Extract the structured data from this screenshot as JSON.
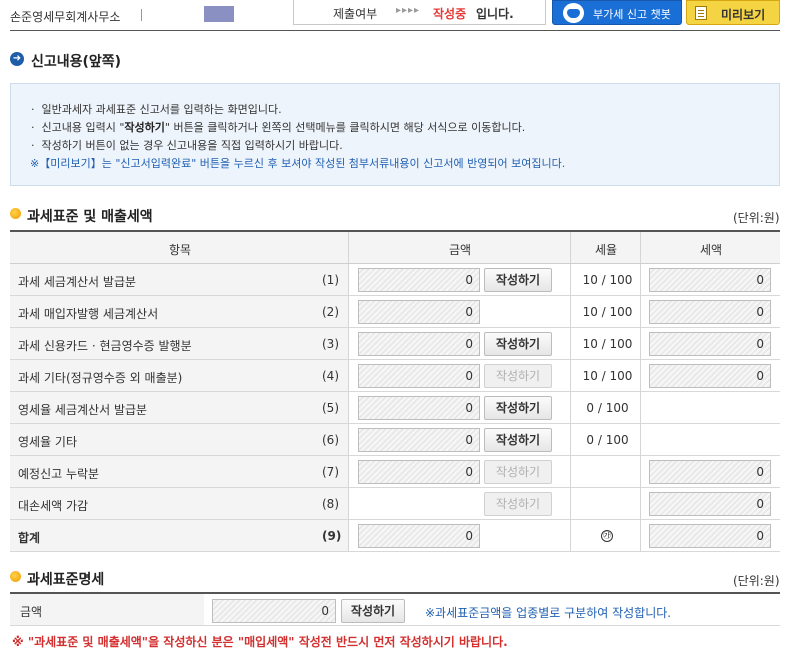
{
  "header": {
    "office_name": "손준영세무회계사무소",
    "status_label": "제출여부",
    "status_arrows": "▸▸▸▸",
    "status_value": "작성중",
    "status_suffix": "입니다.",
    "chatbot_button": "부가세 신고 챗봇",
    "preview_button": "미리보기"
  },
  "section1": {
    "title": "신고내용(앞쪽)",
    "info": {
      "line1": "일반과세자 과세표준 신고서를 입력하는 화면입니다.",
      "line2_pre": "신고내용 입력시 \"",
      "line2_bold": "작성하기",
      "line2_post": "\" 버튼을 클릭하거나 왼쪽의 선택메뉴를 클릭하시면 해당 서식으로 이동합니다.",
      "line3": "작성하기 버튼이 없는 경우 신고내용을 직접 입력하시기 바랍니다.",
      "note": "※【미리보기】는 \"신고서입력완료\" 버튼을 누르신 후 보셔야 작성된 첨부서류내용이 신고서에 반영되어 보여집니다."
    }
  },
  "section2": {
    "title": "과세표준 및 매출세액",
    "unit": "(단위:원)",
    "columns": {
      "item": "항목",
      "amount": "금액",
      "rate": "세율",
      "tax": "세액"
    },
    "write_label": "작성하기",
    "rows": [
      {
        "label": "과세 세금계산서 발급분",
        "num": "(1)",
        "amount": "0",
        "write": "enabled",
        "rate": "10 / 100",
        "tax": "0"
      },
      {
        "label": "과세 매입자발행 세금계산서",
        "num": "(2)",
        "amount": "0",
        "write": "none",
        "rate": "10 / 100",
        "tax": "0"
      },
      {
        "label": "과세 신용카드 · 현금영수증 발행분",
        "num": "(3)",
        "amount": "0",
        "write": "enabled",
        "rate": "10 / 100",
        "tax": "0"
      },
      {
        "label": "과세 기타(정규영수증 외 매출분)",
        "num": "(4)",
        "amount": "0",
        "write": "disabled",
        "rate": "10 / 100",
        "tax": "0"
      },
      {
        "label": "영세율 세금계산서 발급분",
        "num": "(5)",
        "amount": "0",
        "write": "enabled",
        "rate": "0 / 100",
        "tax": null
      },
      {
        "label": "영세율 기타",
        "num": "(6)",
        "amount": "0",
        "write": "enabled",
        "rate": "0 / 100",
        "tax": null
      },
      {
        "label": "예정신고 누락분",
        "num": "(7)",
        "amount": "0",
        "write": "disabled",
        "rate": "",
        "tax": "0"
      },
      {
        "label": "대손세액 가감",
        "num": "(8)",
        "amount": null,
        "write": "disabled",
        "rate": "",
        "tax": "0"
      }
    ],
    "total": {
      "label": "합계",
      "num": "(9)",
      "amount": "0",
      "rate_symbol": "㉮",
      "tax": "0"
    }
  },
  "section3": {
    "title": "과세표준명세",
    "unit": "(단위:원)",
    "label": "금액",
    "amount": "0",
    "write_label": "작성하기",
    "hint": "※과세표준금액을 업종별로 구분하여 작성합니다."
  },
  "warning": "※ \"과세표준 및 매출세액\"을 작성하신 분은 \"매입세액\" 작성전 반드시 먼저 작성하시기 바랍니다."
}
